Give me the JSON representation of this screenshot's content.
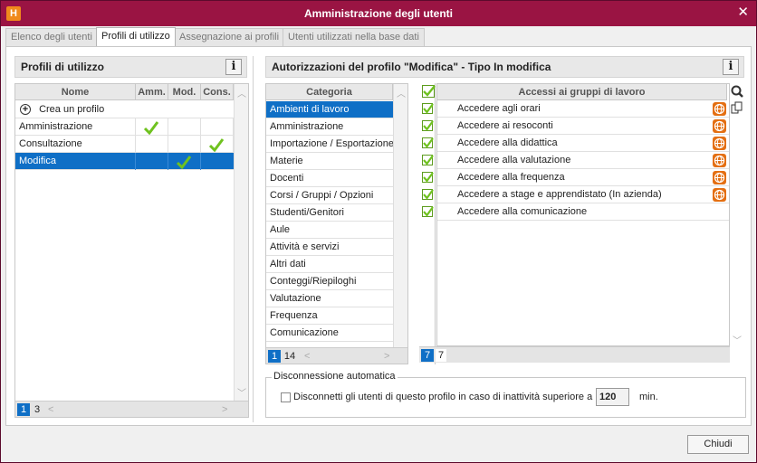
{
  "window": {
    "title": "Amministrazione degli utenti",
    "app_letter": "H"
  },
  "tabs": [
    "Elenco degli utenti",
    "Profili di utilizzo",
    "Assegnazione ai profili",
    "Utenti utilizzati nella base dati"
  ],
  "profiles": {
    "title": "Profili di utilizzo",
    "info": "i",
    "columns": [
      "Nome",
      "Amm.",
      "Mod.",
      "Cons."
    ],
    "create_label": "Crea un profilo",
    "rows": [
      {
        "name": "Amministrazione",
        "amm": true,
        "mod": false,
        "cons": false
      },
      {
        "name": "Consultazione",
        "amm": false,
        "mod": false,
        "cons": true
      },
      {
        "name": "Modifica",
        "amm": false,
        "mod": true,
        "cons": false
      }
    ],
    "page_current": "1",
    "page_total": "3"
  },
  "permissions": {
    "title": "Autorizzazioni del profilo \"Modifica\" - Tipo In modifica",
    "info": "i",
    "category_header": "Categoria",
    "categories": [
      "Ambienti di lavoro",
      "Amministrazione",
      "Importazione / Esportazione",
      "Materie",
      "Docenti",
      "Corsi / Gruppi / Opzioni",
      "Studenti/Genitori",
      "Aule",
      "Attività e servizi",
      "Altri dati",
      "Conteggi/Riepiloghi",
      "Valutazione",
      "Frequenza",
      "Comunicazione"
    ],
    "cat_page_current": "1",
    "cat_page_total": "14",
    "access_header": "Accessi ai gruppi di lavoro",
    "access": [
      {
        "label": "Accedere agli orari",
        "checked": true,
        "web": true
      },
      {
        "label": "Accedere ai resoconti",
        "checked": true,
        "web": true
      },
      {
        "label": "Accedere alla didattica",
        "checked": true,
        "web": true
      },
      {
        "label": "Accedere alla valutazione",
        "checked": true,
        "web": true
      },
      {
        "label": "Accedere alla frequenza",
        "checked": true,
        "web": true
      },
      {
        "label": "Accedere a stage e apprendistato (In azienda)",
        "checked": true,
        "web": true
      },
      {
        "label": "Accedere alla comunicazione",
        "checked": true,
        "web": false
      }
    ],
    "acc_page_current": "7",
    "acc_page_total": "7"
  },
  "disconnect": {
    "legend": "Disconnessione automatica",
    "label": "Disconnetti gli utenti di questo profilo in caso di inattività superiore a",
    "checked": false,
    "value": "120",
    "unit": "min."
  },
  "close_button": "Chiudi",
  "colors": {
    "title_bar": "#9a1443",
    "selection": "#0f6fc6",
    "check": "#6fc21f",
    "web_icon": "#e46f12"
  }
}
